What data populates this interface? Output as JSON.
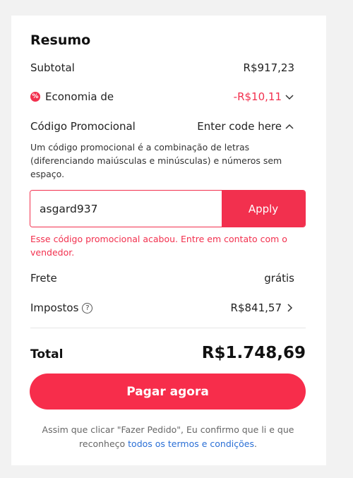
{
  "summary": {
    "title": "Resumo",
    "subtotal_label": "Subtotal",
    "subtotal_value": "R$917,23",
    "discount_label": "Economia de",
    "discount_value": "-R$10,11",
    "promo_label": "Código Promocional",
    "promo_toggle": "Enter code here",
    "promo_description": "Um código promocional é a combinação de letras (diferenciando maiúsculas e minúsculas) e números sem espaço.",
    "promo_input_value": "asgard937",
    "apply_label": "Apply",
    "promo_error": "Esse código promocional acabou. Entre em contato com o vendedor.",
    "shipping_label": "Frete",
    "shipping_value": "grátis",
    "taxes_label": "Impostos",
    "taxes_value": "R$841,57",
    "total_label": "Total",
    "total_value": "R$1.748,69",
    "pay_button": "Pagar agora",
    "terms_text": "Assim que clicar \"Fazer Pedido\", Eu confirmo que li e que reconheço",
    "terms_link": "todos os termos e condições",
    "terms_end": "."
  },
  "colors": {
    "accent": "#f2304e",
    "link": "#2a6fd6"
  },
  "icons": {
    "discount": "discount-badge-icon",
    "discount_chevron": "chevron-down-icon",
    "promo_chevron": "chevron-up-icon",
    "help": "question-circle-icon",
    "taxes_chevron": "chevron-right-icon"
  }
}
